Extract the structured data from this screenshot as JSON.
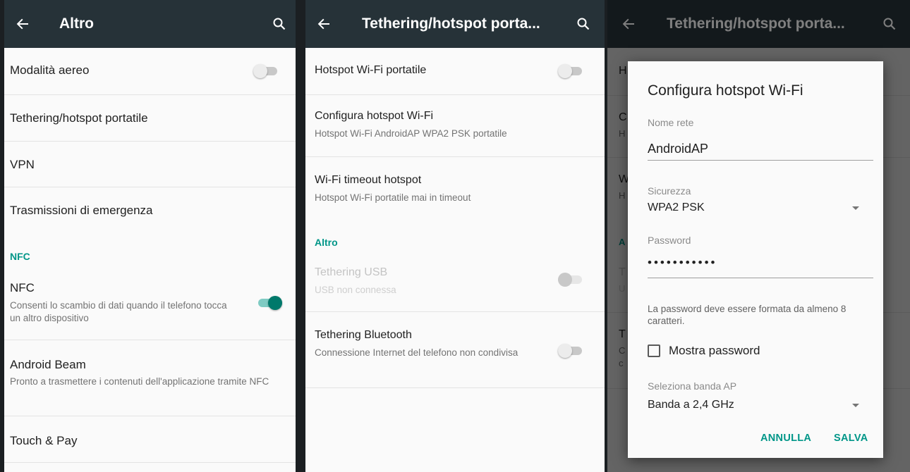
{
  "panel1": {
    "title": "Altro",
    "items": {
      "airplane": "Modalità aereo",
      "tethering": "Tethering/hotspot portatile",
      "vpn": "VPN",
      "emergency": "Trasmissioni di emergenza",
      "nfc_section": "NFC",
      "nfc_title": "NFC",
      "nfc_sub": "Consenti lo scambio di dati quando il telefono tocca un altro dispositivo",
      "beam_title": "Android Beam",
      "beam_sub": "Pronto a trasmettere i contenuti dell'applicazione tramite NFC",
      "touchpay": "Touch & Pay"
    },
    "toggles": {
      "airplane": false,
      "nfc": true
    }
  },
  "panel2": {
    "title": "Tethering/hotspot porta...",
    "items": {
      "hotspot": "Hotspot Wi-Fi portatile",
      "config_title": "Configura hotspot Wi-Fi",
      "config_sub": "Hotspot Wi-Fi AndroidAP WPA2 PSK portatile",
      "timeout_title": "Wi-Fi timeout hotspot",
      "timeout_sub": "Hotspot Wi-Fi portatile mai in timeout",
      "altro_section": "Altro",
      "usb_title": "Tethering USB",
      "usb_sub": "USB non connessa",
      "bt_title": "Tethering Bluetooth",
      "bt_sub": "Connessione Internet del telefono non condivisa"
    },
    "toggles": {
      "hotspot": false,
      "usb": false,
      "bluetooth": false
    }
  },
  "panel3": {
    "title": "Tethering/hotspot porta...",
    "bg_letters": [
      "H",
      "C",
      "H",
      "W",
      "H",
      "A",
      "T",
      "U",
      "T",
      "C",
      "c"
    ],
    "dialog": {
      "title": "Configura hotspot Wi-Fi",
      "network_label": "Nome rete",
      "network_value": "AndroidAP",
      "security_label": "Sicurezza",
      "security_value": "WPA2 PSK",
      "password_label": "Password",
      "password_value": "•••••••••••",
      "help": "La password deve essere formata da almeno 8 caratteri.",
      "show_password": "Mostra password",
      "band_label": "Seleziona banda AP",
      "band_value": "Banda a 2,4 GHz",
      "cancel": "ANNULLA",
      "save": "SALVA"
    }
  },
  "colors": {
    "appbar": "#263238",
    "accent": "#009688",
    "background": "#fafafa"
  }
}
